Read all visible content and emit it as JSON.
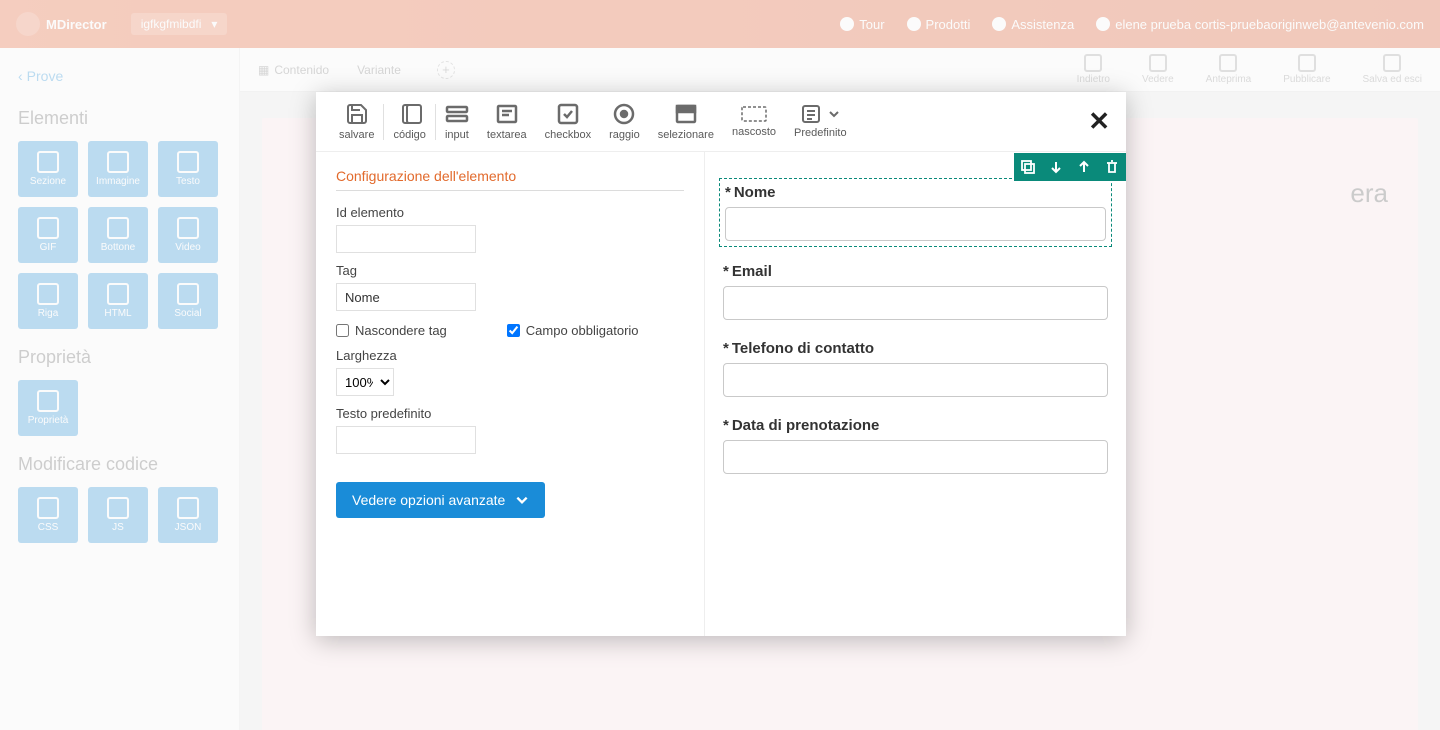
{
  "header": {
    "brand": "MDirector",
    "dropdown": "igfkgfmibdfi",
    "nav": [
      {
        "label": "Tour"
      },
      {
        "label": "Prodotti"
      },
      {
        "label": "Assistenza"
      },
      {
        "label": "elene prueba cortis-pruebaoriginweb@antevenio.com"
      }
    ]
  },
  "left": {
    "back": "Prove",
    "sections": {
      "elements_title": "Elementi",
      "properties_title": "Proprietà",
      "modify_code_title": "Modificare codice"
    },
    "tiles": [
      "Sezione",
      "Immagine",
      "Testo",
      "GIF",
      "Bottone",
      "Video",
      "Riga",
      "HTML",
      "Social"
    ],
    "property_tile": "Proprietà",
    "code_tiles": [
      "CSS",
      "JS",
      "JSON"
    ]
  },
  "content_header": {
    "tab1": "Contenido",
    "tab2": "Variante",
    "right_icons": [
      "Indietro",
      "Vedere",
      "Anteprima",
      "Pubblicare",
      "Salva ed esci"
    ]
  },
  "bg_preview": {
    "heading": "era"
  },
  "modal": {
    "toolbar": [
      {
        "key": "save",
        "label": "salvare"
      },
      {
        "key": "code",
        "label": "código"
      },
      {
        "key": "input",
        "label": "input"
      },
      {
        "key": "textarea",
        "label": "textarea"
      },
      {
        "key": "checkbox",
        "label": "checkbox"
      },
      {
        "key": "radio",
        "label": "raggio"
      },
      {
        "key": "select",
        "label": "selezionare"
      },
      {
        "key": "hidden",
        "label": "nascosto"
      },
      {
        "key": "preset",
        "label": "Predefinito"
      }
    ],
    "config": {
      "title": "Configurazione dell'elemento",
      "id_label": "Id elemento",
      "id_value": "",
      "tag_label": "Tag",
      "tag_value": "Nome",
      "hide_tag_label": "Nascondere tag",
      "hide_tag_checked": false,
      "required_label": "Campo obbligatorio",
      "required_checked": true,
      "width_label": "Larghezza",
      "width_value": "100%",
      "default_text_label": "Testo predefinito",
      "default_text_value": "",
      "advanced_btn": "Vedere opzioni avanzate"
    },
    "preview_fields": [
      {
        "label": "Nome",
        "required": true,
        "selected": true
      },
      {
        "label": "Email",
        "required": true,
        "selected": false
      },
      {
        "label": "Telefono di contatto",
        "required": true,
        "selected": false
      },
      {
        "label": "Data di prenotazione",
        "required": true,
        "selected": false
      }
    ]
  }
}
